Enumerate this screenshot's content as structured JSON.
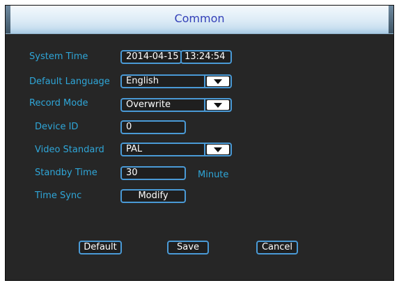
{
  "window": {
    "title": "Common"
  },
  "form": {
    "system_time": {
      "label": "System Time",
      "date": "2014-04-15",
      "time": "13:24:54"
    },
    "default_language": {
      "label": "Default Language",
      "value": "English"
    },
    "record_mode": {
      "label": "Record Mode",
      "value": "Overwrite"
    },
    "device_id": {
      "label": "Device ID",
      "value": "0"
    },
    "video_standard": {
      "label": "Video Standard",
      "value": "PAL"
    },
    "standby_time": {
      "label": "Standby Time",
      "value": "30",
      "unit": "Minute"
    },
    "time_sync": {
      "label": "Time Sync",
      "button": "Modify"
    }
  },
  "buttons": {
    "default": "Default",
    "save": "Save",
    "cancel": "Cancel"
  },
  "colors": {
    "label": "#2fa6d8",
    "border": "#4a9ad6",
    "title": "#3340b8",
    "background": "#262626"
  }
}
